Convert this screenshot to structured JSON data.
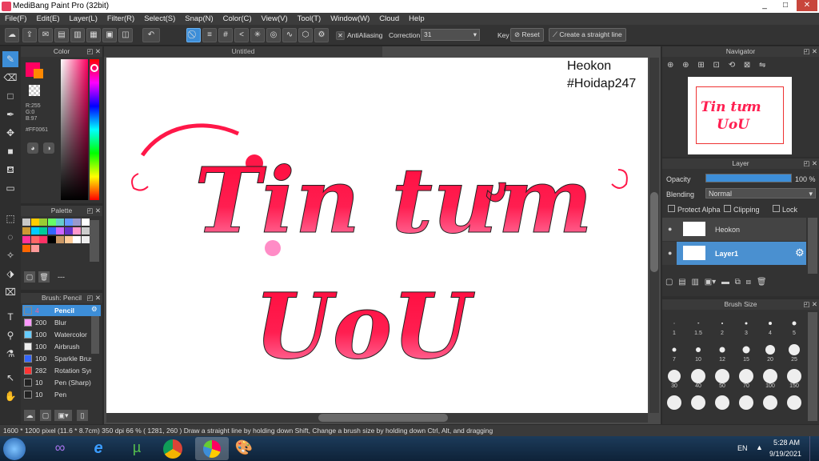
{
  "window": {
    "title": "MediBang Paint Pro (32bit)",
    "min": "_",
    "max": "□",
    "close": "✕"
  },
  "menu": [
    "File(F)",
    "Edit(E)",
    "Layer(L)",
    "Filter(R)",
    "Select(S)",
    "Snap(N)",
    "Color(C)",
    "View(V)",
    "Tool(T)",
    "Window(W)",
    "Cloud",
    "Help"
  ],
  "toolbar": {
    "antialiasing_label": "AntiAliasing",
    "correction_label": "Correction",
    "correction_value": "31",
    "key_label": "Key",
    "reset_label": "Reset",
    "straight_line_label": "Create a straight line"
  },
  "color_panel": {
    "title": "Color",
    "r": "R:255",
    "g": "G:0",
    "b": "B:97",
    "hex": "#FF0061",
    "primary_color": "#ff0061",
    "secondary_color": "#ff8800"
  },
  "palette_panel": {
    "title": "Palette",
    "more": "---",
    "colors": [
      "#c8c8c8",
      "#ffcc00",
      "#99cc33",
      "#66ff66",
      "#66cccc",
      "#6699ff",
      "#9999cc",
      "#ffffff",
      "#cc9933",
      "#00ccff",
      "#00cc99",
      "#3366ff",
      "#cc66ff",
      "#6633cc",
      "#ff99cc",
      "#cccccc",
      "#ff3399",
      "#ff6666",
      "#ff3366",
      "#000000",
      "#cc9966",
      "#ffcc99",
      "#ffffff",
      "#eeeeee",
      "#ff6600",
      "#ff9999"
    ]
  },
  "brush_panel": {
    "title": "Brush: Pencil",
    "items": [
      {
        "size": "4",
        "name": "Pencil",
        "color": "#3d8ed8"
      },
      {
        "size": "200",
        "name": "Blur",
        "color": "#ff99ff"
      },
      {
        "size": "100",
        "name": "Watercolor",
        "color": "#66ccff"
      },
      {
        "size": "100",
        "name": "Airbrush",
        "color": "#eeeeee"
      },
      {
        "size": "100",
        "name": "Sparkle Brush",
        "color": "#3366ff"
      },
      {
        "size": "282",
        "name": "Rotation Symmetry",
        "color": "#ff3333"
      },
      {
        "size": "10",
        "name": "Pen (Sharp)",
        "color": "#222222"
      },
      {
        "size": "10",
        "name": "Pen",
        "color": "#222222"
      }
    ]
  },
  "document": {
    "tab_title": "Untitled"
  },
  "canvas": {
    "watermark_line1": "Heokon",
    "watermark_line2": "#Hoidap247",
    "art_line1": "Tin tưm",
    "art_line2": "UoU"
  },
  "navigator": {
    "title": "Navigator",
    "thumb_text1": "Tin tưm",
    "thumb_text2": "UoU"
  },
  "layer_panel": {
    "title": "Layer",
    "opacity_label": "Opacity",
    "opacity_value": "100 %",
    "opacity_fraction": 1.0,
    "blending_label": "Blending",
    "blending_value": "Normal",
    "protect_alpha": "Protect Alpha",
    "clipping": "Clipping",
    "lock": "Lock",
    "layers": [
      {
        "name": "Heokon",
        "selected": false
      },
      {
        "name": "Layer1",
        "selected": true
      }
    ]
  },
  "brush_size_panel": {
    "title": "Brush Size",
    "sizes": [
      "1",
      "1.5",
      "2",
      "3",
      "4",
      "5",
      "7",
      "10",
      "12",
      "15",
      "20",
      "25",
      "30",
      "40",
      "50",
      "70",
      "100",
      "150",
      "",
      "",
      "",
      "",
      "",
      ""
    ]
  },
  "status": {
    "text": "1600 * 1200 pixel   (11.6 * 8.7cm)   350 dpi   66 %   ( 1281, 260 )   Draw a straight line by holding down Shift, Change a brush size by holding down Ctrl, Alt, and dragging"
  },
  "taskbar": {
    "lang": "EN",
    "time": "5:28 AM",
    "date": "9/19/2021"
  }
}
